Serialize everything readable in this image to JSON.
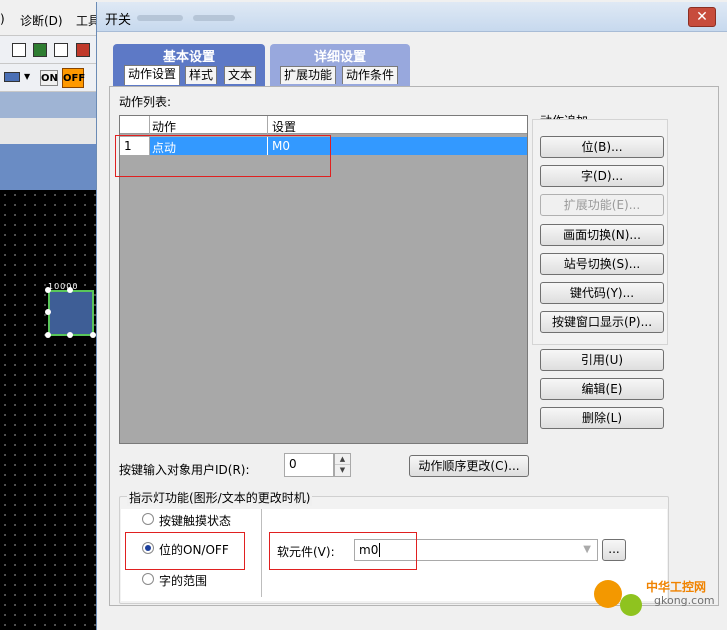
{
  "background_app": {
    "menu": [
      ")",
      "诊断(D)",
      "工具"
    ],
    "toolbar": {
      "on_label": "ON",
      "off_label": "OFF",
      "off_color": "#ff9900"
    },
    "switch_text": "10000"
  },
  "dialog": {
    "title": "开关",
    "close_label": "✕",
    "tab_groups": [
      {
        "title": "基本设置",
        "tabs": [
          "动作设置",
          "样式",
          "文本"
        ]
      },
      {
        "title": "详细设置",
        "tabs": [
          "扩展功能",
          "动作条件"
        ]
      }
    ],
    "action_list": {
      "label": "动作列表:",
      "columns": [
        "动作",
        "设置"
      ],
      "rows": [
        {
          "num": "1",
          "action": "点动",
          "setting": "M0"
        }
      ],
      "selected_color": "#3399ff"
    },
    "action_add": {
      "label": "动作追加",
      "buttons": [
        {
          "label": "位(B)...",
          "enabled": true
        },
        {
          "label": "字(D)...",
          "enabled": true
        },
        {
          "label": "扩展功能(E)...",
          "enabled": false
        },
        {
          "label": "画面切换(N)...",
          "enabled": true
        },
        {
          "label": "站号切换(S)...",
          "enabled": true
        },
        {
          "label": "键代码(Y)...",
          "enabled": true
        },
        {
          "label": "按键窗口显示(P)...",
          "enabled": true
        }
      ]
    },
    "edit_buttons": [
      "引用(U)",
      "编辑(E)",
      "删除(L)"
    ],
    "user_id": {
      "label": "按键输入对象用户ID(R):",
      "value": "0"
    },
    "reorder_button": "动作顺序更改(C)...",
    "indicator": {
      "legend": "指示灯功能(图形/文本的更改时机)",
      "options": [
        {
          "label": "按键触摸状态",
          "checked": false
        },
        {
          "label": "位的ON/OFF",
          "checked": true
        },
        {
          "label": "字的范围",
          "checked": false
        }
      ],
      "device_label": "软元件(V):",
      "device_value": "m0",
      "browse_label": "..."
    }
  },
  "watermark": {
    "name": "中华工控网",
    "url": "gkong.com"
  }
}
